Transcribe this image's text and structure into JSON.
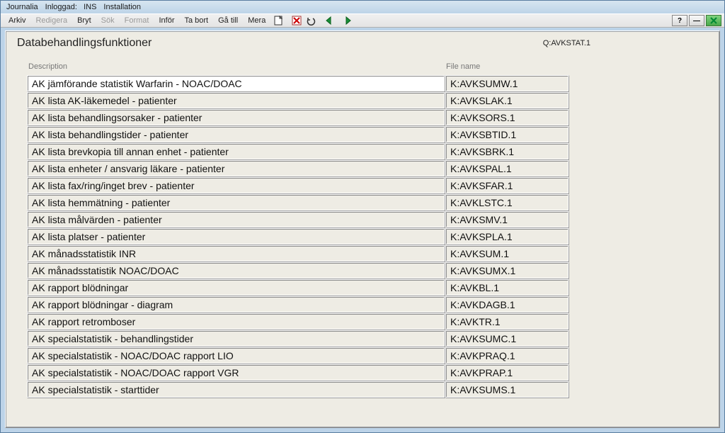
{
  "titlebar": {
    "app": "Journalia",
    "logged_label": "Inloggad:",
    "user": "INS",
    "env": "Installation"
  },
  "menu": {
    "arkiv": "Arkiv",
    "redigera": "Redigera",
    "bryt": "Bryt",
    "sok": "Sök",
    "format": "Format",
    "infor": "Inför",
    "tabort": "Ta bort",
    "gatill": "Gå till",
    "mera": "Mera"
  },
  "toolbar_right": {
    "help": "?",
    "minimize": "—",
    "close": "×"
  },
  "page": {
    "title": "Databehandlingsfunktioner",
    "status_filename": "Q:AVKSTAT.1",
    "col_desc": "Description",
    "col_file": "File name"
  },
  "rows": [
    {
      "desc": "AK jämförande statistik Warfarin - NOAC/DOAC",
      "file": "K:AVKSUMW.1",
      "selected": true
    },
    {
      "desc": "AK lista AK-läkemedel - patienter",
      "file": "K:AVKSLAK.1"
    },
    {
      "desc": "AK lista behandlingsorsaker - patienter",
      "file": "K:AVKSORS.1"
    },
    {
      "desc": "AK lista behandlingstider - patienter",
      "file": "K:AVKSBTID.1"
    },
    {
      "desc": "AK lista brevkopia till annan enhet - patienter",
      "file": "K:AVKSBRK.1"
    },
    {
      "desc": "AK lista enheter / ansvarig läkare - patienter",
      "file": "K:AVKSPAL.1"
    },
    {
      "desc": "AK lista fax/ring/inget brev - patienter",
      "file": "K:AVKSFAR.1"
    },
    {
      "desc": "AK lista hemmätning - patienter",
      "file": "K:AVKLSTC.1"
    },
    {
      "desc": "AK lista målvärden - patienter",
      "file": "K:AVKSMV.1"
    },
    {
      "desc": "AK lista platser - patienter",
      "file": "K:AVKSPLA.1"
    },
    {
      "desc": "AK månadsstatistik INR",
      "file": "K:AVKSUM.1"
    },
    {
      "desc": "AK månadsstatistik NOAC/DOAC",
      "file": "K:AVKSUMX.1"
    },
    {
      "desc": "AK rapport blödningar",
      "file": "K:AVKBL.1"
    },
    {
      "desc": "AK rapport blödningar - diagram",
      "file": "K:AVKDAGB.1"
    },
    {
      "desc": "AK rapport retromboser",
      "file": "K:AVKTR.1"
    },
    {
      "desc": "AK specialstatistik - behandlingstider",
      "file": "K:AVKSUMC.1"
    },
    {
      "desc": "AK specialstatistik - NOAC/DOAC rapport LIO",
      "file": "K:AVKPRAQ.1"
    },
    {
      "desc": "AK specialstatistik - NOAC/DOAC rapport VGR",
      "file": "K:AVKPRAP.1"
    },
    {
      "desc": "AK specialstatistik - starttider",
      "file": "K:AVKSUMS.1"
    }
  ]
}
